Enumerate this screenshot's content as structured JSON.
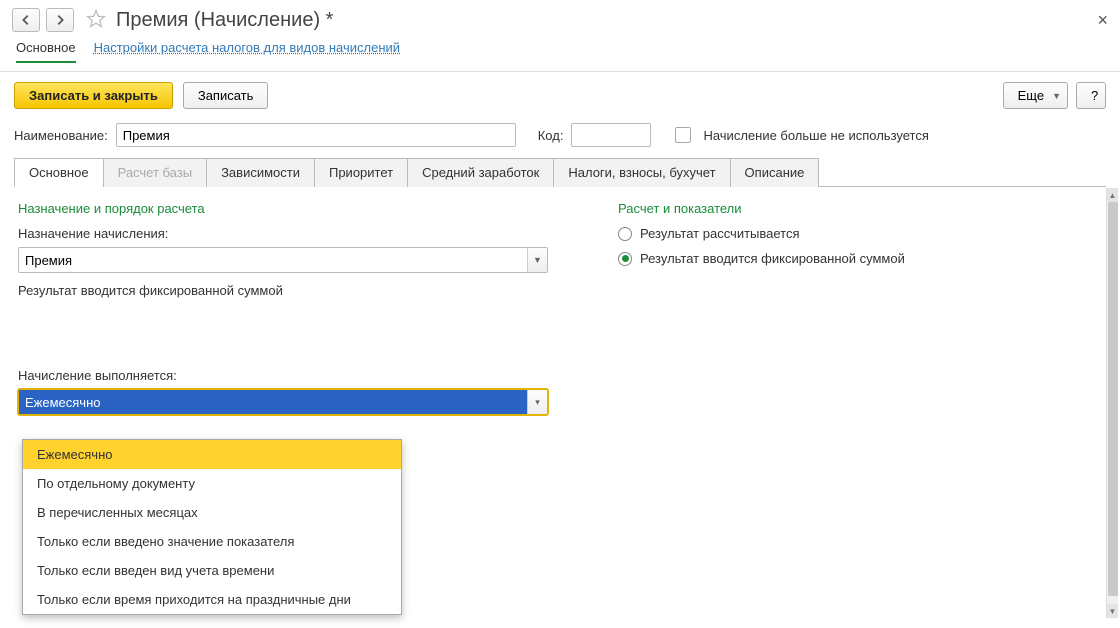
{
  "header": {
    "title": "Премия (Начисление) *"
  },
  "sections": {
    "main": "Основное",
    "tax_link": "Настройки расчета налогов для видов начислений"
  },
  "toolbar": {
    "save_close": "Записать и закрыть",
    "save": "Записать",
    "more": "Еще",
    "help": "?"
  },
  "fields": {
    "name_label": "Наименование:",
    "name_value": "Премия",
    "code_label": "Код:",
    "code_value": "",
    "unused_label": "Начисление больше не используется"
  },
  "tabs": [
    "Основное",
    "Расчет базы",
    "Зависимости",
    "Приоритет",
    "Средний заработок",
    "Налоги, взносы, бухучет",
    "Описание"
  ],
  "left": {
    "section_title": "Назначение и порядок расчета",
    "purpose_label": "Назначение начисления:",
    "purpose_value": "Премия",
    "result_note": "Результат вводится фиксированной суммой",
    "execution_label": "Начисление выполняется:",
    "execution_value": "Ежемесячно"
  },
  "right": {
    "section_title": "Расчет и показатели",
    "radio1": "Результат рассчитывается",
    "radio2": "Результат вводится фиксированной суммой"
  },
  "dropdown": {
    "items": [
      "Ежемесячно",
      "По отдельному документу",
      "В перечисленных месяцах",
      "Только если введено значение показателя",
      "Только если введен вид учета времени",
      "Только если время приходится на праздничные дни"
    ]
  }
}
